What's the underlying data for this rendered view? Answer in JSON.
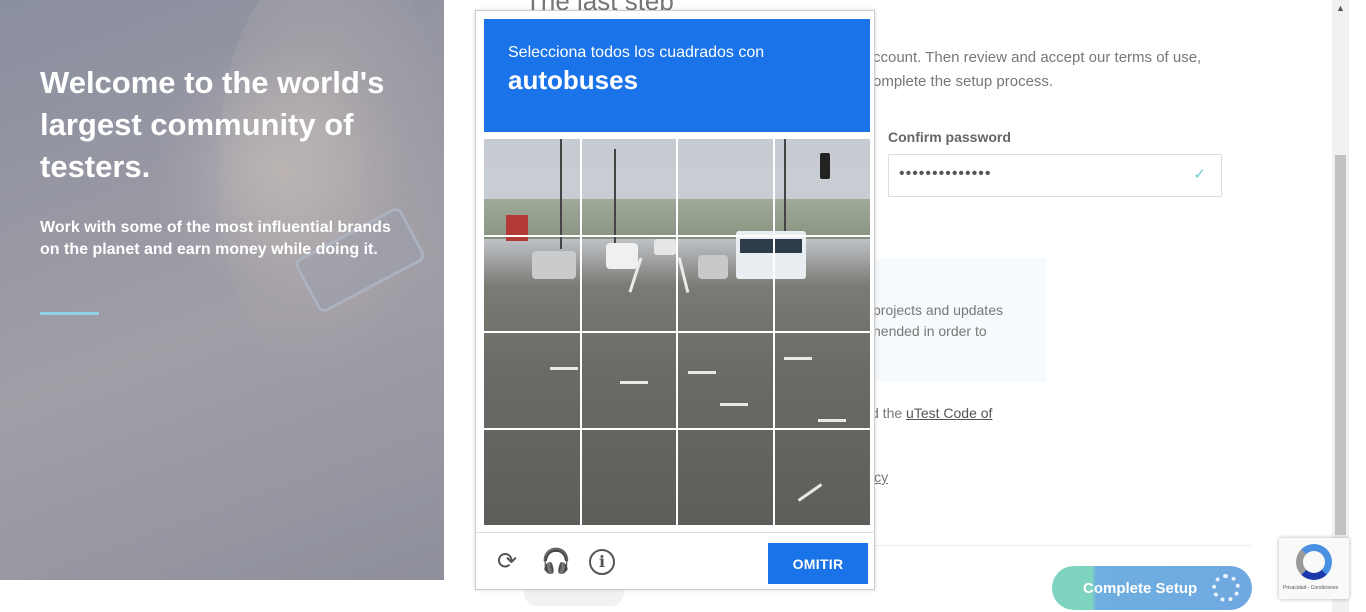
{
  "hero": {
    "title": "Welcome to the world's largest community of testers.",
    "subtitle": "Work with some of the most influential brands on the planet and earn money while doing it."
  },
  "form": {
    "step_title": "The last step",
    "intro": "ccount. Then review and accept our terms of use, omplete the setup process.",
    "confirm_password_label": "Confirm password",
    "confirm_password_value": "••••••••••••••",
    "info_text": "projects and updates nended in order to",
    "code_prefix": "d the ",
    "code_link": "uTest Code of",
    "policy_fragment": "icy",
    "complete_setup": "Complete Setup"
  },
  "captcha": {
    "instruction": "Selecciona todos los cuadrados con",
    "object": "autobuses",
    "skip_label": "OMITIR",
    "tiles": 16
  },
  "recaptcha_badge": {
    "terms": "Privacidad - Condiciones"
  },
  "colors": {
    "captcha_blue": "#1a73e8",
    "hero_rule": "#8ed3e6",
    "setup_green": "#7fd4c0",
    "setup_blue": "#6fa8e0"
  },
  "icons": [
    "reload-icon",
    "headphones-icon",
    "info-icon",
    "check-icon",
    "spinner-icon",
    "recaptcha-logo-icon",
    "scroll-up-icon"
  ]
}
